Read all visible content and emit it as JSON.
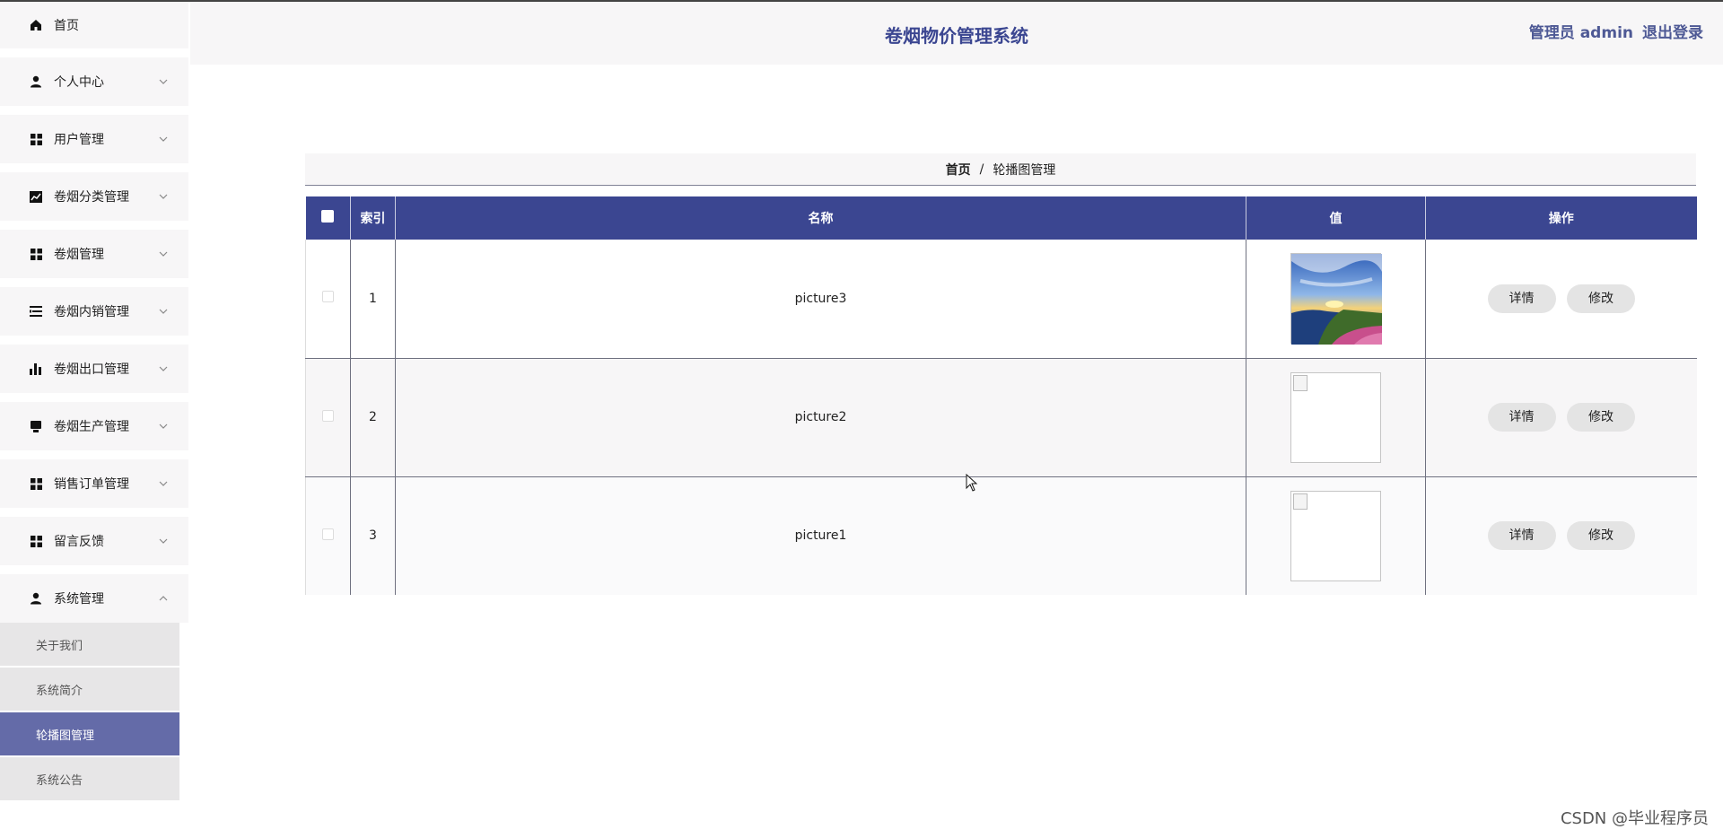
{
  "app": {
    "title": "卷烟物价管理系统"
  },
  "header": {
    "role_user": "管理员 admin",
    "logout": "退出登录"
  },
  "sidebar": {
    "items": [
      {
        "label": "首页",
        "icon": "home-icon",
        "expandable": false
      },
      {
        "label": "个人中心",
        "icon": "person-icon",
        "expandable": true
      },
      {
        "label": "用户管理",
        "icon": "grid-icon",
        "expandable": true
      },
      {
        "label": "卷烟分类管理",
        "icon": "chart-line-icon",
        "expandable": true
      },
      {
        "label": "卷烟管理",
        "icon": "grid-icon",
        "expandable": true
      },
      {
        "label": "卷烟内销管理",
        "icon": "list-icon",
        "expandable": true
      },
      {
        "label": "卷烟出口管理",
        "icon": "bar-chart-icon",
        "expandable": true
      },
      {
        "label": "卷烟生产管理",
        "icon": "monitor-icon",
        "expandable": true
      },
      {
        "label": "销售订单管理",
        "icon": "grid-icon",
        "expandable": true
      },
      {
        "label": "留言反馈",
        "icon": "grid-icon",
        "expandable": true
      },
      {
        "label": "系统管理",
        "icon": "person-icon",
        "expandable": true,
        "expanded": true
      }
    ],
    "subitems": [
      {
        "label": "关于我们",
        "active": false
      },
      {
        "label": "系统简介",
        "active": false
      },
      {
        "label": "轮播图管理",
        "active": true
      },
      {
        "label": "系统公告",
        "active": false
      }
    ]
  },
  "breadcrumb": {
    "home": "首页",
    "separator": "/",
    "current": "轮播图管理"
  },
  "table": {
    "headers": {
      "index": "索引",
      "name": "名称",
      "value": "值",
      "actions": "操作"
    },
    "rows": [
      {
        "index": "1",
        "name": "picture3",
        "image": "loaded"
      },
      {
        "index": "2",
        "name": "picture2",
        "image": "broken"
      },
      {
        "index": "3",
        "name": "picture1",
        "image": "broken"
      }
    ],
    "actions": {
      "detail": "详情",
      "edit": "修改"
    }
  },
  "watermark": "CSDN @毕业程序员",
  "colors": {
    "primary": "#3b4691",
    "active_menu": "#646ba8",
    "panel": "#f7f6f7"
  }
}
